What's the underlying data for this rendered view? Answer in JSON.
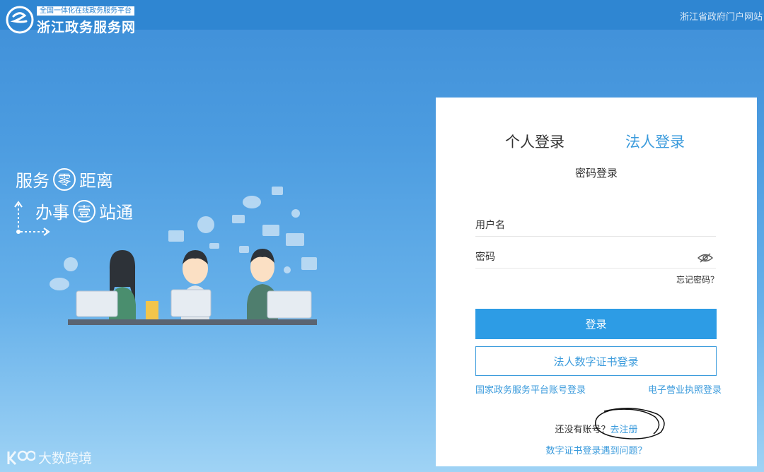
{
  "header": {
    "tagline": "全国一体化在线政务服务平台",
    "site_name": "浙江政务服务网",
    "portal_link": "浙江省政府门户网站"
  },
  "banner": {
    "slogan1_before": "服务",
    "slogan1_circle": "零",
    "slogan1_after": "距离",
    "slogan2_before": "办事",
    "slogan2_circle": "壹",
    "slogan2_after": "站通"
  },
  "login": {
    "tabs": [
      {
        "label": "个人登录",
        "active": true
      },
      {
        "label": "法人登录",
        "active": false
      }
    ],
    "subtitle": "密码登录",
    "username_placeholder": "用户名",
    "password_placeholder": "密码",
    "forgot_password": "忘记密码？",
    "login_button": "登录",
    "cert_button": "法人数字证书登录",
    "national_link": "国家政务服务平台账号登录",
    "license_link": "电子营业执照登录",
    "no_account": "还没有账号？",
    "register_link": "去注册",
    "cert_problem": "数字证书登录遇到问题？"
  },
  "watermark": {
    "text": "大数跨境"
  },
  "colors": {
    "top_bar": "#2f86d2",
    "accent": "#2d9ce5",
    "link": "#3b9bdc"
  }
}
